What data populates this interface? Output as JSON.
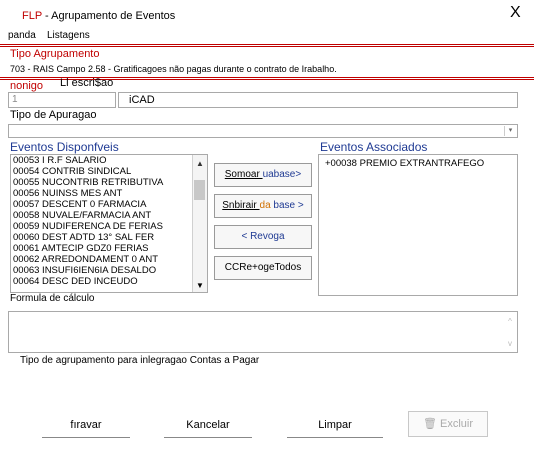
{
  "window": {
    "title_code": "FLP",
    "title_text": " - Agrupamento de Eventos",
    "close_label": "X"
  },
  "menu": {
    "items": [
      "panda",
      "Listagens"
    ]
  },
  "tipo_agrupamento": {
    "label": "Tipo Agrupamento",
    "value": "703 - RAIS Campo 2.58 - Gratificagoes não pagas durante o contrato de Irabalho."
  },
  "form": {
    "codigo_label": "nonigo",
    "descricao_label": "Ll escri$ao",
    "codigo_value": "1",
    "descricao_value": "iCAD",
    "apuracao_label": "Tipo de Apuragao",
    "apuracao_value": ""
  },
  "eventos_disponiveis": {
    "title": "Eventos Disponfveis",
    "items": [
      "00053 I R.F  SALARIO",
      "00054 CONTRIB SINDICAL",
      "00055 NUCONTRIB RETRIBUTIVA",
      "00056 NUINSS MES ANT",
      "00057 DESCENT 0 FARMACIA",
      "00058 NUVALE/FARMACIA ANT",
      "00059 NUDIFERENCA DE FERIAS",
      "00060 DEST ADTD 13° SAL FER",
      "00061 AMTECIP GDZ0 FERIAS",
      "00062 ARREDONDAMENT 0 ANT",
      "00063 INSUFI6IEN6IA  DESALDO",
      "00064 DESC DED INCEUDO"
    ]
  },
  "eventos_associados": {
    "title": "Eventos Associados",
    "items": [
      "+00038 PREMIO EXTRANTRAFEGO"
    ]
  },
  "middle_buttons": {
    "somar_prefix": "Somoar ",
    "somar_suffix": "uabase>",
    "subtrair_prefix": "Snbirair ",
    "subtrair_mid": "da",
    "subtrair_suffix": " base >",
    "revoga": "< Revoga",
    "remove_todos": "CCRe+ogeTodos"
  },
  "formula": {
    "label": "Formula de cálculo",
    "value": ""
  },
  "integracao": {
    "label": "Tipo de agrupamento para inlegragao Contas a Pagar"
  },
  "footer": {
    "gravar": "fıravar",
    "cancelar": "Kancelar",
    "limpar": "Limpar",
    "excluir": "Excluir"
  },
  "colors": {
    "accent_red": "#c00000",
    "section_blue": "#1f3a93",
    "subtrair_da": "#d07000",
    "subtrair_base": "#1f3a93",
    "somar_base": "#1f3a93"
  }
}
